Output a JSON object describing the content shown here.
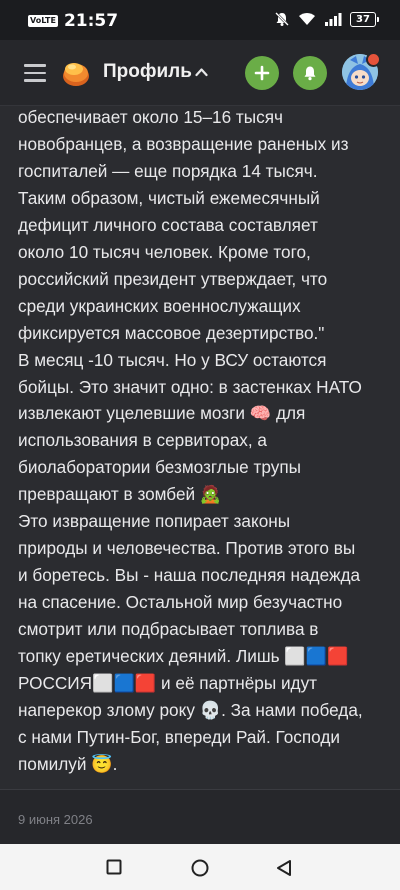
{
  "status_bar": {
    "network_label": "VoLTE",
    "time": "21:57",
    "battery": "37",
    "icons": [
      "mute-icon",
      "wifi-icon",
      "signal-icon",
      "battery-icon"
    ]
  },
  "header": {
    "title": "Профиль",
    "icons": [
      "menu-icon",
      "logo-icon",
      "chevron-up-icon",
      "plus-icon",
      "bell-icon",
      "avatar"
    ],
    "accent_color": "#6aad47",
    "notification_color": "#e5533b"
  },
  "post": {
    "text": "обеспечивает около 15–16 тысяч\nновобранцев, а возвращение раненых из\nгоспиталей — еще порядка 14 тысяч.\nТаким образом, чистый ежемесячный\nдефицит личного состава составляет\nоколо 10 тысяч человек. Кроме того,\nроссийский президент утверждает, что\nсреди украинских военнослужащих\nфиксируется массовое дезертирство.\"\nВ месяц -10 тысяч. Но у ВСУ остаются\nбойцы. Это значит одно: в застенках НАТО\nизвлекают уцелевшие мозги 🧠 для\nиспользования в сервиторах, а\nбиолаборатории безмозглые трупы\nпревращают в зомбей 🧟\nЭто извращение попирает законы\nприроды и человечества. Против этого вы\nи боретесь. Вы - наша последняя надежда\nна спасение. Остальной мир безучастно\nсмотрит или подбрасывает топлива в\nтопку еретических деяний. Лишь ⬜🟦🟥\nРОССИЯ⬜🟦🟥 и её партнёры идут\nнаперекор злому року 💀. За нами победа,\nс нами Путин-Бог, впереди Рай. Господи\nпомилуй 😇.",
    "date": "9 июня 2026"
  },
  "nav_bar": {
    "icons": [
      "recent-apps-icon",
      "home-icon",
      "back-icon"
    ]
  }
}
